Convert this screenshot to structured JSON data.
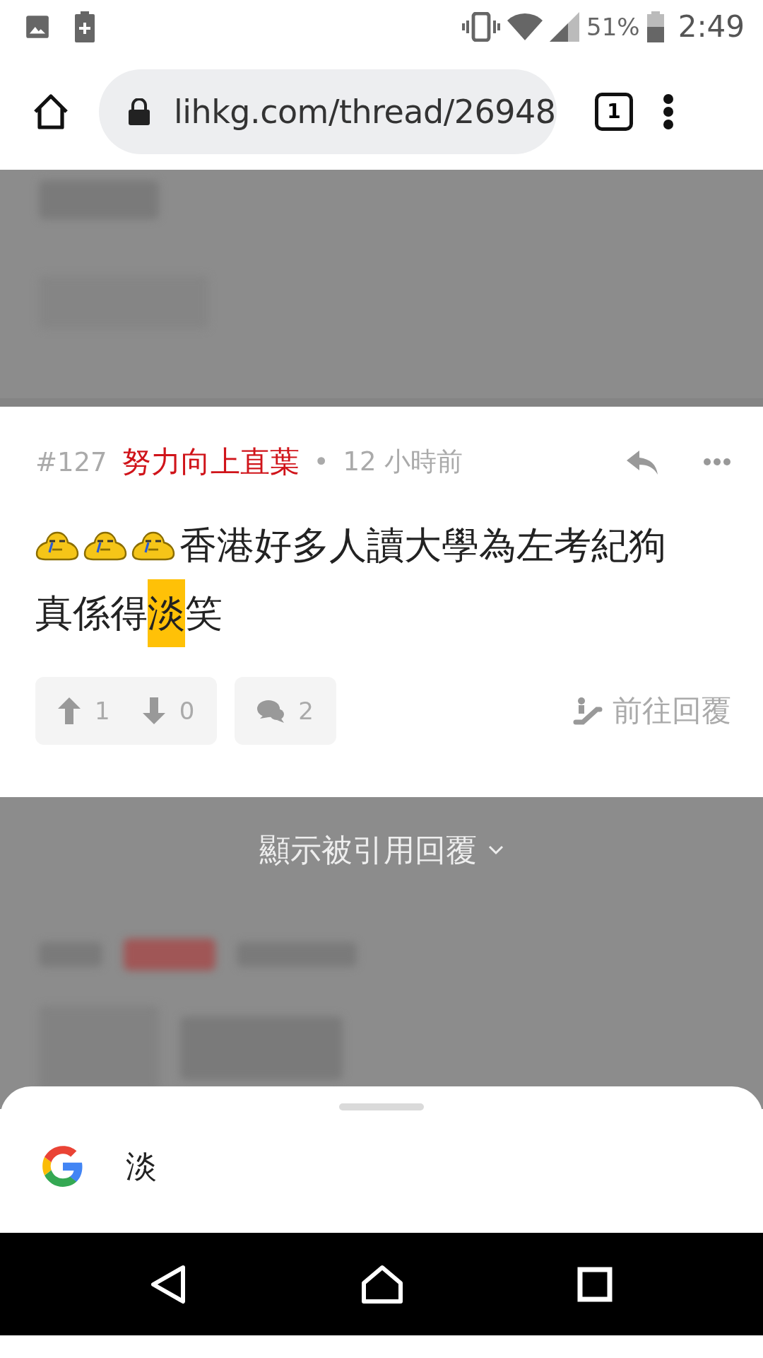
{
  "status_bar": {
    "battery": "51%",
    "time": "2:49"
  },
  "browser": {
    "url": "lihkg.com/thread/26948",
    "tab_count": "1"
  },
  "post": {
    "number": "#127",
    "author": "努力向上直葉",
    "separator": "•",
    "time": "12 小時前",
    "lines": [
      [
        {
          "kind": "emoji"
        },
        {
          "kind": "emoji"
        },
        {
          "kind": "emoji"
        },
        {
          "kind": "text",
          "text": "香港好多人讀大學為左考紀狗",
          "highlighted": false
        }
      ],
      [
        {
          "kind": "text",
          "text": "真係得",
          "highlighted": false
        },
        {
          "kind": "text",
          "text": "淡",
          "highlighted": true
        },
        {
          "kind": "text",
          "text": "笑",
          "highlighted": false
        }
      ]
    ],
    "upvotes": "1",
    "downvotes": "0",
    "quotes": "2",
    "goto_reply": "前往回覆"
  },
  "quoted_toggle": {
    "label": "顯示被引用回覆"
  },
  "search_sheet": {
    "query": "淡"
  }
}
